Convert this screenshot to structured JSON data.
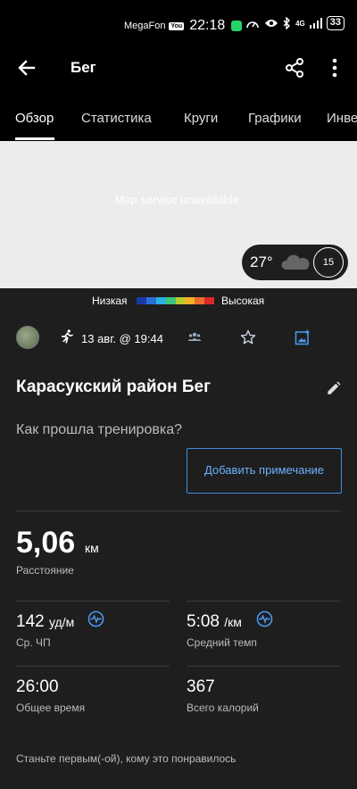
{
  "status": {
    "carrier": "MegaFon",
    "badge": "YouTube",
    "time": "22:18",
    "network": "4G",
    "battery": "33"
  },
  "appbar": {
    "title": "Бег"
  },
  "tabs": [
    "Обзор",
    "Статистика",
    "Круги",
    "Графики",
    "Инве"
  ],
  "map": {
    "message": "Map service unavailable.",
    "temperature": "27°",
    "wind": "15"
  },
  "legend": {
    "low": "Низкая",
    "high": "Высокая",
    "colors": [
      "#1a3aa8",
      "#2a6fd8",
      "#2bb0e0",
      "#3fc47a",
      "#b9cc2e",
      "#f2b127",
      "#ef6b2a",
      "#d82a2a"
    ]
  },
  "activity": {
    "date": "13 авг. @ 19:44",
    "title": "Карасукский район Бег",
    "prompt": "Как прошла тренировка?",
    "add_note": "Добавить примечание"
  },
  "stats": {
    "distance": {
      "value": "5,06",
      "unit": "км",
      "label": "Расстояние"
    },
    "avg_hr": {
      "value": "142",
      "unit": "уд/м",
      "label": "Ср. ЧП"
    },
    "avg_pace": {
      "value": "5:08",
      "unit": "/км",
      "label": "Средний темп"
    },
    "total_time": {
      "value": "26:00",
      "label": "Общее время"
    },
    "calories": {
      "value": "367",
      "label": "Всего калорий"
    }
  },
  "likes_text": "Станьте первым(-ой), кому это понравилось"
}
